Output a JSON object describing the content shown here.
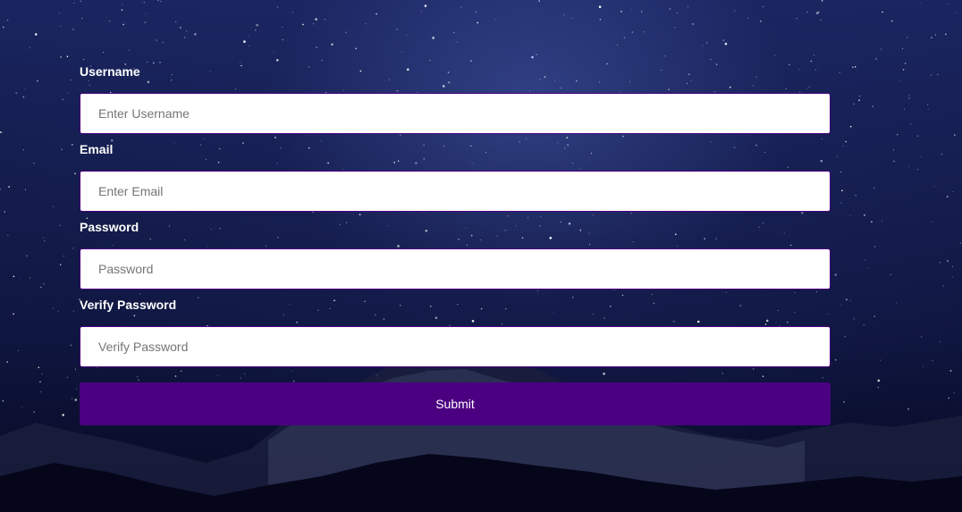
{
  "form": {
    "username": {
      "label": "Username",
      "placeholder": "Enter Username",
      "value": ""
    },
    "email": {
      "label": "Email",
      "placeholder": "Enter Email",
      "value": ""
    },
    "password": {
      "label": "Password",
      "placeholder": "Password",
      "value": ""
    },
    "verify_password": {
      "label": "Verify Password",
      "placeholder": "Verify Password",
      "value": ""
    },
    "submit_label": "Submit"
  },
  "colors": {
    "accent": "#4b0082",
    "label_text": "#ffffff",
    "input_background": "#ffffff",
    "background": "#141d4d"
  },
  "background_image": "starry-night-sky-with-mountains"
}
